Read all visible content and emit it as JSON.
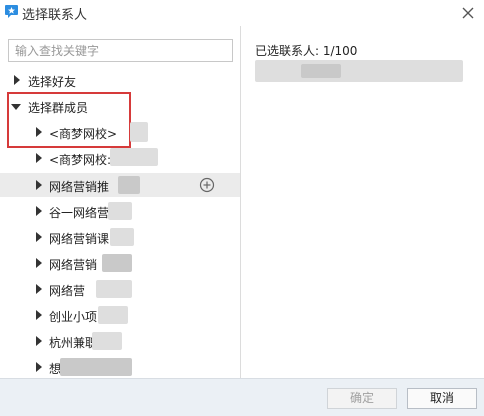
{
  "window": {
    "title": "选择联系人"
  },
  "search": {
    "placeholder": "输入查找关键字"
  },
  "tree": {
    "friends_label": "选择好友",
    "groups_label": "选择群成员",
    "groups": [
      {
        "label": "<商梦网校>"
      },
      {
        "label": "<商梦网校:"
      },
      {
        "label": "网络营销推"
      },
      {
        "label": "谷一网络营"
      },
      {
        "label": "网络营销课"
      },
      {
        "label": "网络营销"
      },
      {
        "label": "网络营"
      },
      {
        "label": "创业小项"
      },
      {
        "label": "杭州兼职"
      },
      {
        "label": "想"
      }
    ]
  },
  "selected": {
    "count_label": "已选联系人: 1/100"
  },
  "buttons": {
    "confirm": "确定",
    "cancel": "取消"
  },
  "colors": {
    "highlight_box": "#d63a3a",
    "app_icon": "#2c8de0",
    "bottom_bar": "#ebf0f5"
  }
}
